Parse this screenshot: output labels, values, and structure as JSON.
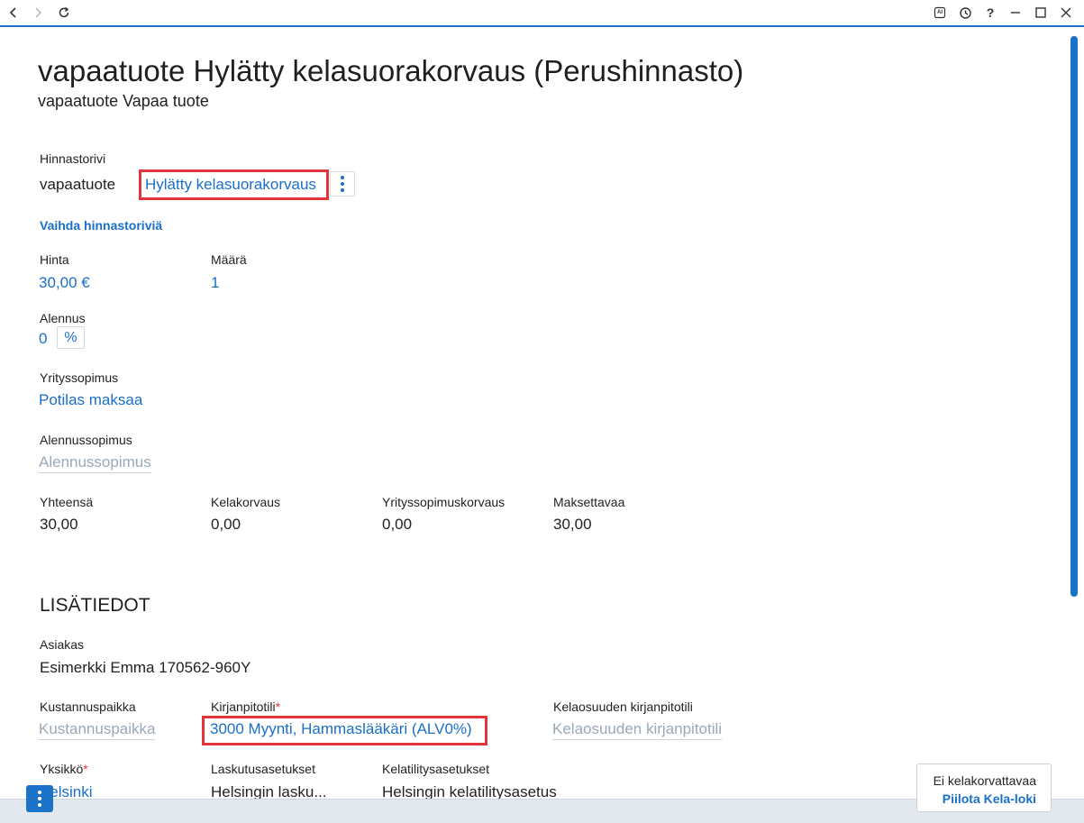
{
  "header": {
    "title": "vapaatuote Hylätty kelasuorakorvaus (Perushinnasto)",
    "subtitle": "vapaatuote Vapaa tuote"
  },
  "titlebar": {
    "ai_label": "AI",
    "help_label": "?"
  },
  "price_row": {
    "label": "Hinnastorivi",
    "product": "vapaatuote",
    "row_link": "Hylätty kelasuorakorvaus",
    "change_link": "Vaihda hinnastoriviä"
  },
  "price": {
    "label": "Hinta",
    "value": "30,00 €"
  },
  "quantity": {
    "label": "Määrä",
    "value": "1"
  },
  "discount": {
    "label": "Alennus",
    "value": "0",
    "unit": "%"
  },
  "company_contract": {
    "label": "Yrityssopimus",
    "value": "Potilas maksaa"
  },
  "discount_contract": {
    "label": "Alennussopimus",
    "placeholder": "Alennussopimus"
  },
  "totals": [
    {
      "label": "Yhteensä",
      "value": "30,00"
    },
    {
      "label": "Kelakorvaus",
      "value": "0,00"
    },
    {
      "label": "Yrityssopimuskorvaus",
      "value": "0,00"
    },
    {
      "label": "Maksettavaa",
      "value": "30,00"
    }
  ],
  "additional": {
    "heading": "LISÄTIEDOT",
    "customer_label": "Asiakas",
    "customer_value": "Esimerkki Emma 170562-960Y",
    "cost_center_label": "Kustannuspaikka",
    "cost_center_placeholder": "Kustannuspaikka",
    "account_label": "Kirjanpitotili",
    "account_required": "*",
    "account_value": "3000 Myynti, Hammaslääkäri (ALV0%)",
    "kela_account_label": "Kelaosuuden kirjanpitotili",
    "kela_account_placeholder": "Kelaosuuden kirjanpitotili",
    "unit_label": "Yksikkö",
    "unit_required": "*",
    "unit_value": "Helsinki",
    "billing_label": "Laskutusasetukset",
    "billing_value": "Helsingin lasku...",
    "kela_settings_label": "Kelatilitysasetukset",
    "kela_settings_value": "Helsingin kelatilitysasetus"
  },
  "kela_panel": {
    "status": "Ei kelakorvattavaa",
    "toggle": "Piilota Kela-loki"
  },
  "colors": {
    "accent": "#1a73c8",
    "link": "#1a6fc9",
    "highlight": "#e2343b",
    "required": "#e2343b"
  }
}
